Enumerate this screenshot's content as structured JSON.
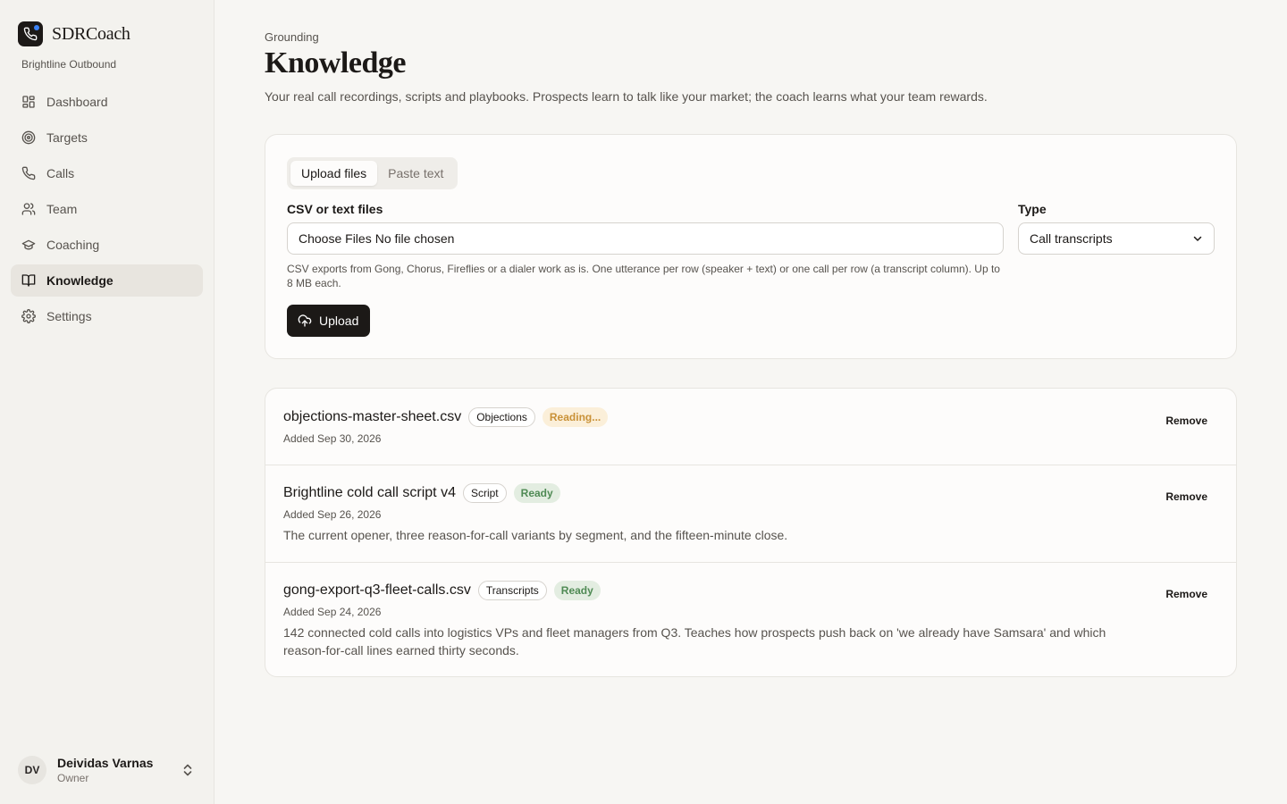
{
  "brand": {
    "name": "SDRCoach",
    "org": "Brightline Outbound"
  },
  "nav": [
    {
      "label": "Dashboard",
      "icon": "dashboard-icon"
    },
    {
      "label": "Targets",
      "icon": "target-icon"
    },
    {
      "label": "Calls",
      "icon": "phone-icon"
    },
    {
      "label": "Team",
      "icon": "team-icon"
    },
    {
      "label": "Coaching",
      "icon": "graduation-cap-icon"
    },
    {
      "label": "Knowledge",
      "icon": "book-icon",
      "active": true
    },
    {
      "label": "Settings",
      "icon": "gear-icon"
    }
  ],
  "user": {
    "initials": "DV",
    "name": "Deividas Varnas",
    "role": "Owner"
  },
  "page": {
    "eyebrow": "Grounding",
    "title": "Knowledge",
    "description": "Your real call recordings, scripts and playbooks. Prospects learn to talk like your market; the coach learns what your team rewards."
  },
  "upload": {
    "tabs": [
      "Upload files",
      "Paste text"
    ],
    "active_tab": "Upload files",
    "files_label": "CSV or text files",
    "choose_files": "Choose Files",
    "no_file": "No file chosen",
    "type_label": "Type",
    "type_value": "Call transcripts",
    "hint": "CSV exports from Gong, Chorus, Fireflies or a dialer work as is. One utterance per row (speaker + text) or one call per row (a transcript column). Up to 8 MB each.",
    "button": "Upload"
  },
  "items": [
    {
      "title": "objections-master-sheet.csv",
      "tag": "Objections",
      "status": "Reading...",
      "date": "Added Sep 30, 2026",
      "description": "",
      "remove": "Remove"
    },
    {
      "title": "Brightline cold call script v4",
      "tag": "Script",
      "status": "Ready",
      "date": "Added Sep 26, 2026",
      "description": "The current opener, three reason-for-call variants by segment, and the fifteen-minute close.",
      "remove": "Remove"
    },
    {
      "title": "gong-export-q3-fleet-calls.csv",
      "tag": "Transcripts",
      "status": "Ready",
      "date": "Added Sep 24, 2026",
      "description": "142 connected cold calls into logistics VPs and fleet managers from Q3. Teaches how prospects push back on 'we already have Samsara' and which reason-for-call lines earned thirty seconds.",
      "remove": "Remove"
    }
  ],
  "colors": {
    "accent": "#1c1917",
    "reading": "#c99137",
    "ready": "#4f8a54",
    "logo_dot": "#3b82f6"
  }
}
